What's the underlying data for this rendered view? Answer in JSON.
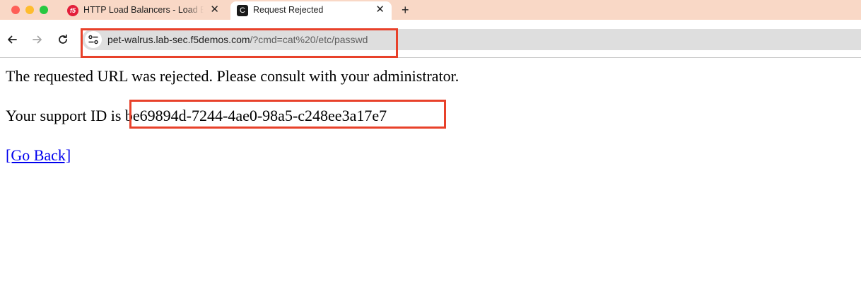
{
  "window": {
    "controls": [
      "close",
      "minimize",
      "zoom"
    ]
  },
  "tabs": [
    {
      "title": "HTTP Load Balancers - Load Balancers",
      "favicon": "f5-logo-icon",
      "favicon_text": "f5",
      "close_label": "✕",
      "active": false
    },
    {
      "title": "Request Rejected",
      "favicon": "c-square-icon",
      "favicon_text": "C",
      "close_label": "✕",
      "active": true
    }
  ],
  "new_tab_label": "+",
  "toolbar": {
    "back_icon": "arrow-left-icon",
    "forward_icon": "arrow-right-icon",
    "reload_icon": "reload-icon",
    "site_info_icon": "tune-icon"
  },
  "address_bar": {
    "host": "pet-walrus.lab-sec.f5demos.com",
    "path": "/?cmd=cat%20/etc/passwd"
  },
  "page": {
    "message": "The requested URL was rejected. Please consult with your administrator.",
    "support_prefix": "Your support ID is",
    "support_id": "be69894d-7244-4ae0-98a5-c248ee3a17e7",
    "go_back_link": "[Go Back]"
  },
  "colors": {
    "tab_strip": "#f9d8c6",
    "highlight_border": "#e8412a",
    "link": "#0000ee"
  }
}
